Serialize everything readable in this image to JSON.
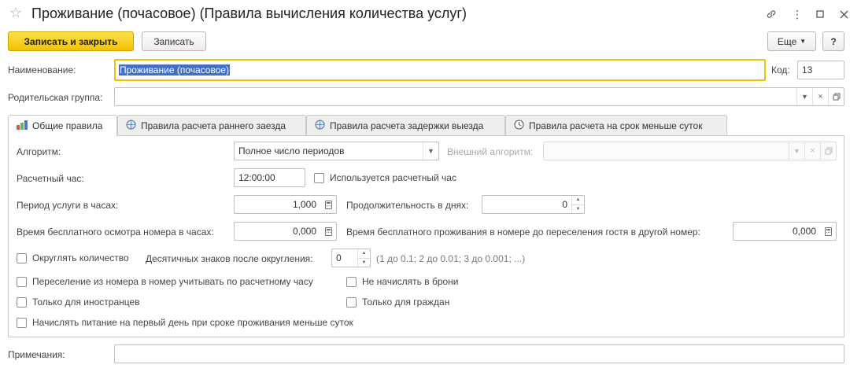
{
  "window": {
    "title": "Проживание (почасовое) (Правила вычисления количества услуг)"
  },
  "toolbar": {
    "save_close_label": "Записать и закрыть",
    "save_label": "Записать",
    "more_label": "Еще",
    "help_label": "?"
  },
  "header": {
    "name_label": "Наименование:",
    "name_value": "Проживание (почасовое)",
    "code_label": "Код:",
    "code_value": "13",
    "parent_label": "Родительская группа:",
    "parent_value": ""
  },
  "tabs": [
    {
      "label": "Общие правила",
      "icon": "rules-icon"
    },
    {
      "label": "Правила расчета раннего заезда",
      "icon": "globe-icon"
    },
    {
      "label": "Правила расчета задержки выезда",
      "icon": "globe-icon"
    },
    {
      "label": "Правила расчета на срок меньше суток",
      "icon": "clock-icon"
    }
  ],
  "general": {
    "algorithm_label": "Алгоритм:",
    "algorithm_value": "Полное число периодов",
    "external_algorithm_label": "Внешний алгоритм:",
    "external_algorithm_value": "",
    "calc_hour_label": "Расчетный час:",
    "calc_hour_value": "12:00:00",
    "uses_calc_hour_label": "Используется расчетный час",
    "service_period_label": "Период услуги в часах:",
    "service_period_value": "1,000",
    "duration_days_label": "Продолжительность в днях:",
    "duration_days_value": "0",
    "free_inspection_label": "Время бесплатного осмотра номера в часах:",
    "free_inspection_value": "0,000",
    "free_stay_label": "Время бесплатного проживания в номере до переселения гостя в другой номер:",
    "free_stay_value": "0,000",
    "round_qty_label": "Округлять количество",
    "decimals_label": "Десятичных знаков после округления:",
    "decimals_value": "0",
    "decimals_hint": "(1 до 0.1; 2 до 0.01; 3 до 0.001; ...)",
    "room_move_label": "Переселение из номера в номер учитывать по расчетному часу",
    "no_charge_booking_label": "Не начислять в брони",
    "foreigners_only_label": "Только для иностранцев",
    "citizens_only_label": "Только для граждан",
    "meals_first_day_label": "Начислять питание на первый день при сроке проживания меньше суток"
  },
  "notes": {
    "label": "Примечания:",
    "value": ""
  }
}
